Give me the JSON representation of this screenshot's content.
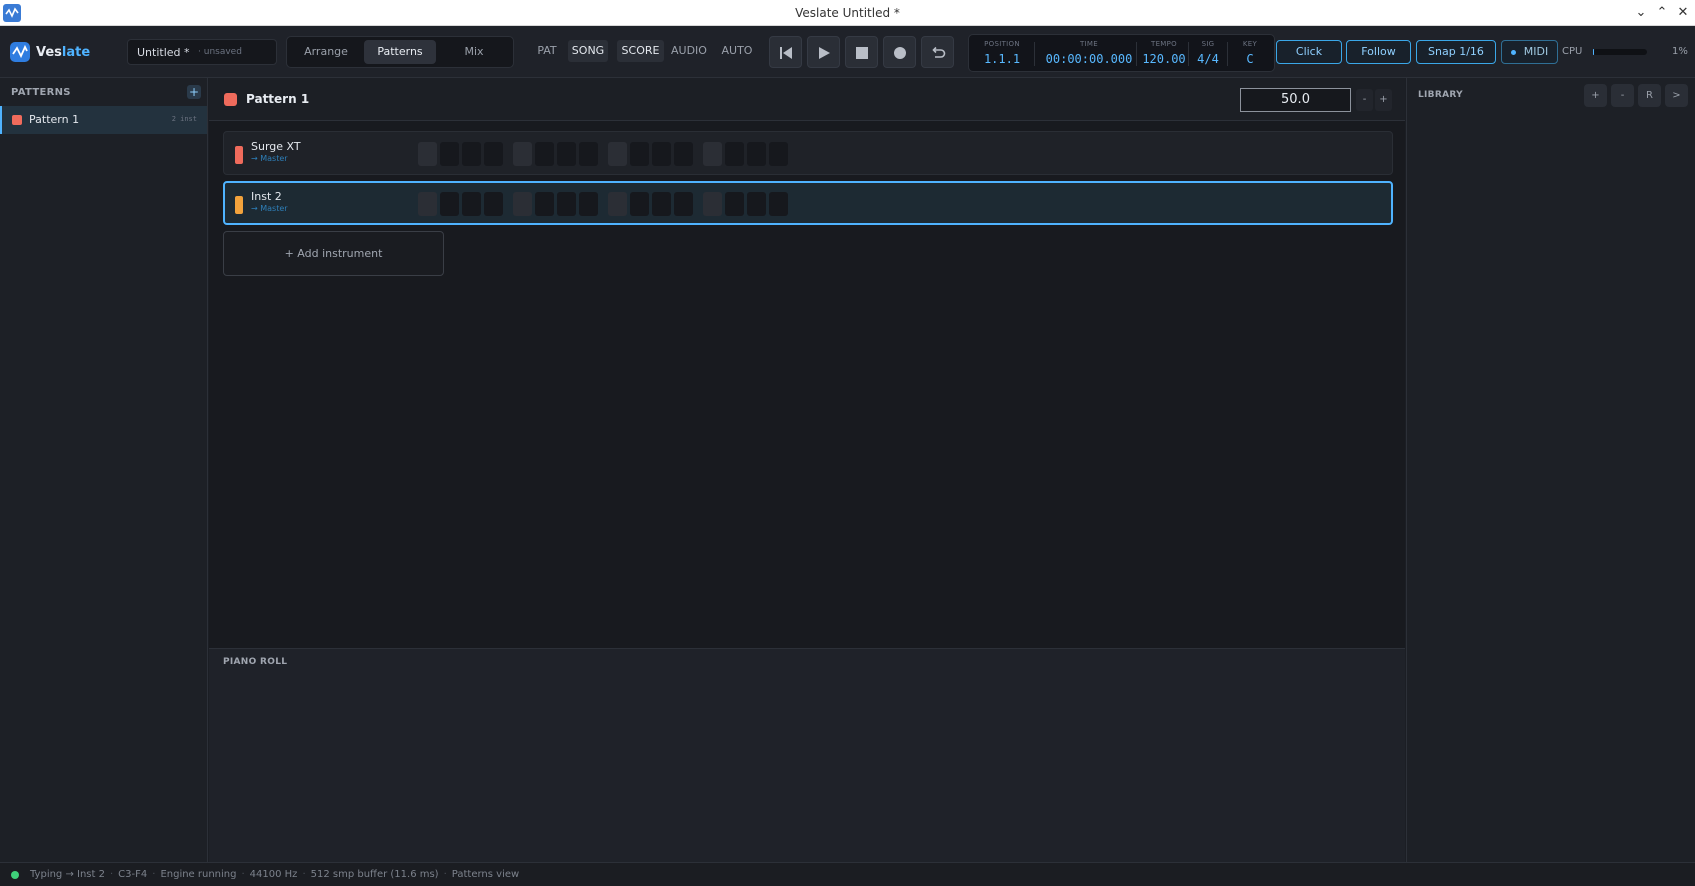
{
  "window": {
    "title": "Veslate Untitled *"
  },
  "brand": {
    "name_a": "Ves",
    "name_b": "late",
    "accent": "#4fb3ff"
  },
  "project": {
    "name": "Untitled",
    "dirty_mark": "*",
    "state": "unsaved"
  },
  "view_tabs": [
    {
      "label": "Arrange",
      "active": false
    },
    {
      "label": "Patterns",
      "active": true
    },
    {
      "label": "Mix",
      "active": false
    }
  ],
  "modes": [
    {
      "label": "PAT",
      "active": false
    },
    {
      "label": "SONG",
      "active": true
    },
    {
      "label": "SCORE",
      "active": true
    },
    {
      "label": "AUDIO",
      "active": false
    },
    {
      "label": "AUTO",
      "active": false
    }
  ],
  "transport": {
    "icons": [
      "skip-back-icon",
      "play-icon",
      "stop-icon",
      "record-icon",
      "loop-icon"
    ]
  },
  "lcd": {
    "position_label": "POSITION",
    "position": "1.1.1",
    "time_label": "TIME",
    "time": "00:00:00.000",
    "tempo_label": "TEMPO",
    "tempo": "120.00",
    "sig_label": "SIG",
    "sig": "4/4",
    "key_label": "KEY",
    "key": "C"
  },
  "toggles": {
    "click": "Click",
    "follow": "Follow",
    "snap": "Snap 1/16",
    "midi": "MIDI"
  },
  "cpu": {
    "label": "CPU",
    "value": "1%",
    "fraction": 0.01
  },
  "patterns_panel": {
    "title": "PATTERNS",
    "add_label": "+",
    "items": [
      {
        "name": "Pattern 1",
        "count": "2 inst",
        "color": "#ef6b5c"
      }
    ]
  },
  "editor": {
    "pattern_name": "Pattern 1",
    "pattern_color": "#ef6b5c",
    "value": "50.0",
    "minus": "-",
    "plus": "+",
    "tracks": [
      {
        "name": "Surge XT",
        "route": "→ Master",
        "color": "#ef6b5c",
        "selected": false
      },
      {
        "name": "Inst 2",
        "route": "→ Master",
        "color": "#f2a23c",
        "selected": true
      }
    ],
    "add_instrument": "+ Add instrument"
  },
  "piano_roll": {
    "title": "PIANO ROLL"
  },
  "library": {
    "title": "LIBRARY",
    "buttons": [
      "+",
      "-",
      "R",
      ">"
    ]
  },
  "status": {
    "items": [
      "Typing → Inst 2",
      "C3-F4",
      "Engine running",
      "44100 Hz",
      "512 smp buffer (11.6 ms)",
      "Patterns view"
    ]
  }
}
